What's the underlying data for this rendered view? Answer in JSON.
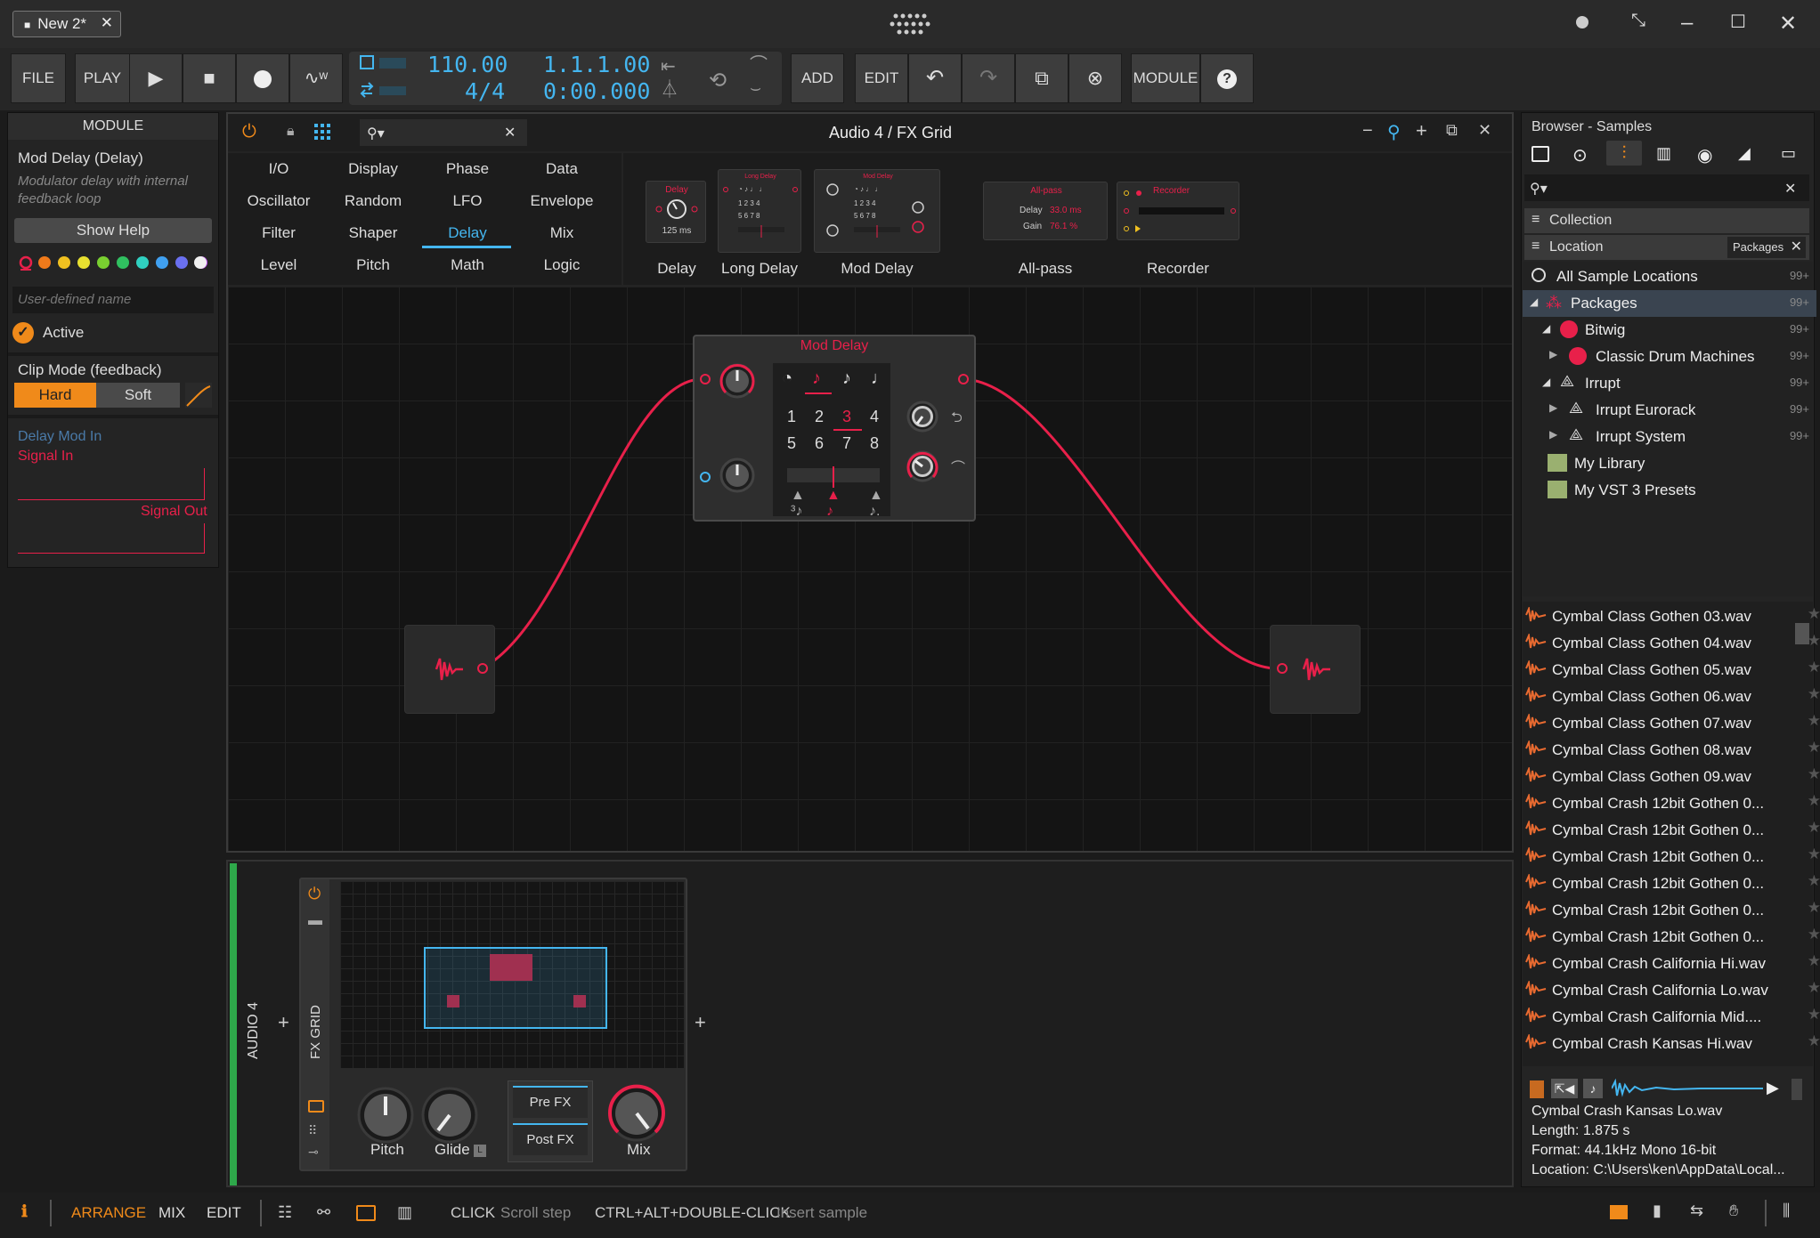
{
  "titlebar": {
    "tab_label": "New 2*",
    "tab_close": "✕"
  },
  "toolbar": {
    "file": "FILE",
    "play": "PLAY",
    "add": "ADD",
    "edit": "EDIT",
    "module": "MODULE",
    "tempo": "110.00",
    "time_sig": "4/4",
    "position": "1.1.1.00",
    "time": "0:00.000"
  },
  "module_panel": {
    "header": "MODULE",
    "title": "Mod Delay (Delay)",
    "description": "Modulator delay with internal feedback loop",
    "show_help": "Show Help",
    "colors": [
      "#e8204a",
      "#f07a1a",
      "#f0c020",
      "#e8e030",
      "#7ad030",
      "#30c060",
      "#30d0c0",
      "#40a0f0",
      "#6a70f0",
      "#c050f0",
      "#f0f0f0"
    ],
    "name_placeholder": "User-defined name",
    "active_label": "Active",
    "clip_mode_label": "Clip Mode (feedback)",
    "clip_hard": "Hard",
    "clip_soft": "Soft",
    "delay_mod_in": "Delay Mod In",
    "signal_in": "Signal In",
    "signal_out": "Signal Out"
  },
  "fxgrid": {
    "title": "Audio 4 / FX Grid",
    "categories": [
      [
        "I/O",
        "Display",
        "Phase",
        "Data"
      ],
      [
        "Oscillator",
        "Random",
        "LFO",
        "Envelope"
      ],
      [
        "Filter",
        "Shaper",
        "Delay",
        "Mix"
      ],
      [
        "Level",
        "Pitch",
        "Math",
        "Logic"
      ]
    ],
    "selected_category": "Delay",
    "thumbs": {
      "delay": {
        "name": "Delay",
        "header": "Delay",
        "value": "125 ms"
      },
      "long_delay": {
        "name": "Long Delay",
        "header": "Long Delay"
      },
      "mod_delay": {
        "name": "Mod Delay",
        "header": "Mod Delay"
      },
      "allpass": {
        "name": "All-pass",
        "header": "All-pass",
        "delay_label": "Delay",
        "delay_value": "33.0 ms",
        "gain_label": "Gain",
        "gain_value": "76.1 %"
      },
      "recorder": {
        "name": "Recorder",
        "header": "Recorder"
      }
    },
    "mod_delay_module": {
      "title": "Mod Delay",
      "digits": [
        "1",
        "2",
        "3",
        "4",
        "5",
        "6",
        "7",
        "8"
      ],
      "active_digit": "3"
    }
  },
  "device_panel": {
    "track_label": "AUDIO 4",
    "device_label": "FX GRID",
    "knobs": [
      "Pitch",
      "Glide",
      "Mix"
    ],
    "pre_fx": "Pre FX",
    "post_fx": "Post FX",
    "plus": "+"
  },
  "browser": {
    "title": "Browser - Samples",
    "collection": "Collection",
    "location": "Location",
    "packages_tag": "Packages",
    "tree": [
      {
        "label": "All Sample Locations",
        "count": "99+"
      },
      {
        "label": "Packages",
        "count": "99+"
      },
      {
        "label": "Bitwig",
        "count": "99+"
      },
      {
        "label": "Classic Drum Machines",
        "count": "99+"
      },
      {
        "label": "Irrupt",
        "count": "99+"
      },
      {
        "label": "Irrupt Eurorack",
        "count": "99+"
      },
      {
        "label": "Irrupt System",
        "count": "99+"
      },
      {
        "label": "My Library",
        "count": ""
      },
      {
        "label": "My VST 3 Presets",
        "count": ""
      }
    ],
    "files": [
      "Cymbal Class Gothen 03.wav",
      "Cymbal Class Gothen 04.wav",
      "Cymbal Class Gothen 05.wav",
      "Cymbal Class Gothen 06.wav",
      "Cymbal Class Gothen 07.wav",
      "Cymbal Class Gothen 08.wav",
      "Cymbal Class Gothen 09.wav",
      "Cymbal Crash 12bit Gothen 0...",
      "Cymbal Crash 12bit Gothen 0...",
      "Cymbal Crash 12bit Gothen 0...",
      "Cymbal Crash 12bit Gothen 0...",
      "Cymbal Crash 12bit Gothen 0...",
      "Cymbal Crash 12bit Gothen 0...",
      "Cymbal Crash California Hi.wav",
      "Cymbal Crash California Lo.wav",
      "Cymbal Crash California Mid....",
      "Cymbal Crash Kansas Hi.wav"
    ],
    "preview": {
      "name": "Cymbal Crash Kansas Lo.wav",
      "length": "Length: 1.875 s",
      "format": "Format: 44.1kHz Mono 16-bit",
      "location": "Location: C:\\Users\\ken\\AppData\\Local..."
    }
  },
  "statusbar": {
    "arrange": "ARRANGE",
    "mix": "MIX",
    "edit": "EDIT",
    "hint1_key": "CLICK",
    "hint1_action": "Scroll step",
    "hint2_key": "CTRL+ALT+DOUBLE-CLICK",
    "hint2_action": "Insert sample"
  }
}
